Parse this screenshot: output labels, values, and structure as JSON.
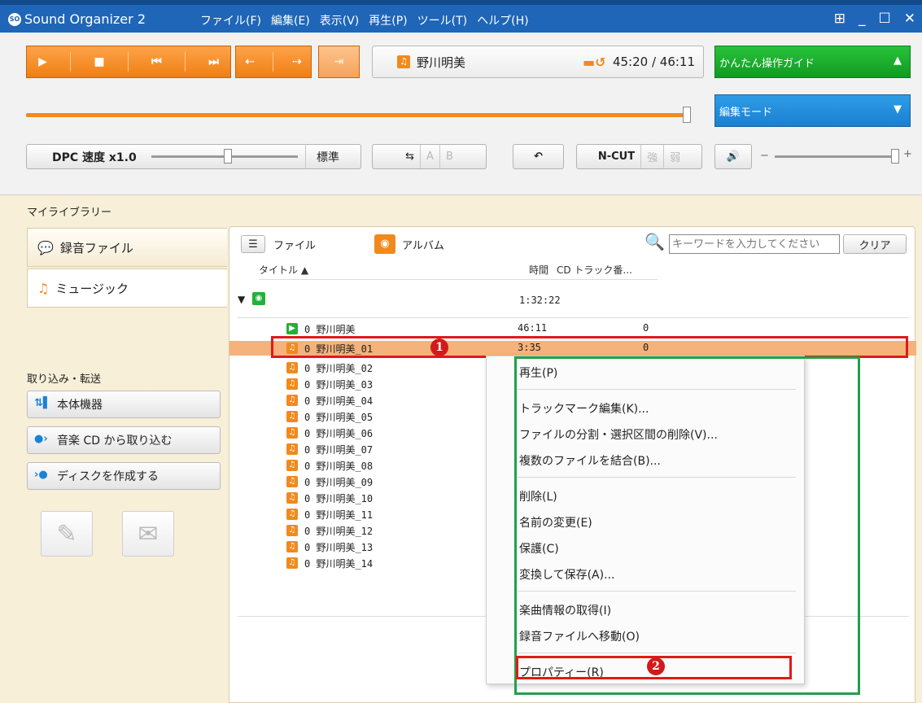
{
  "window": {
    "title": "Sound Organizer 2",
    "menu": [
      "ファイル(F)",
      "編集(E)",
      "表示(V)",
      "再生(P)",
      "ツール(T)",
      "ヘルプ(H)"
    ]
  },
  "player": {
    "now_playing_title": "野川明美",
    "time": "45:20 / 46:11",
    "guide_button": "かんたん操作ガイド",
    "mode_button": "編集モード",
    "dpc_label": "DPC 速度 x1.0",
    "standard_button": "標準",
    "ab_a": "A",
    "ab_b": "B",
    "ncut": "N-CUT",
    "strong": "強",
    "weak": "弱"
  },
  "sidebar": {
    "library_label": "マイライブラリー",
    "tabs": [
      {
        "label": "録音ファイル"
      },
      {
        "label": "ミュージック"
      }
    ],
    "transfer_label": "取り込み・転送",
    "buttons": [
      {
        "label": "本体機器"
      },
      {
        "label": "音楽 CD から取り込む"
      },
      {
        "label": "ディスクを作成する"
      }
    ]
  },
  "list": {
    "view_file": "ファイル",
    "view_album": "アルバム",
    "search_placeholder": "キーワードを入力してください",
    "clear_button": "クリア",
    "col_title": "タイトル ▲",
    "col_time": "時間",
    "col_track": "CD トラック番...",
    "group_time": "1:32:22",
    "rows": [
      {
        "name": "0 野川明美",
        "time": "46:11",
        "track": "0"
      },
      {
        "name": "0 野川明美_01",
        "time": "3:35",
        "track": "0"
      },
      {
        "name": "0 野川明美_02"
      },
      {
        "name": "0 野川明美_03"
      },
      {
        "name": "0 野川明美_04"
      },
      {
        "name": "0 野川明美_05"
      },
      {
        "name": "0 野川明美_06"
      },
      {
        "name": "0 野川明美_07"
      },
      {
        "name": "0 野川明美_08"
      },
      {
        "name": "0 野川明美_09"
      },
      {
        "name": "0 野川明美_10"
      },
      {
        "name": "0 野川明美_11"
      },
      {
        "name": "0 野川明美_12"
      },
      {
        "name": "0 野川明美_13"
      },
      {
        "name": "0 野川明美_14"
      }
    ]
  },
  "context_menu": {
    "items": [
      "再生(P)",
      "トラックマーク編集(K)...",
      "ファイルの分割・選択区間の削除(V)...",
      "複数のファイルを結合(B)...",
      "削除(L)",
      "名前の変更(E)",
      "保護(C)",
      "変換して保存(A)...",
      "楽曲情報の取得(I)",
      "録音ファイルへ移動(O)",
      "プロパティー(R)"
    ]
  },
  "annotations": {
    "badge1": "1",
    "badge2": "2"
  },
  "colors": {
    "title_bar": "#1f66b8",
    "orange_accent": "#f08a1c",
    "selection": "#f5b27a",
    "highlight_red": "#e01a1a",
    "highlight_green": "#21a04a"
  }
}
